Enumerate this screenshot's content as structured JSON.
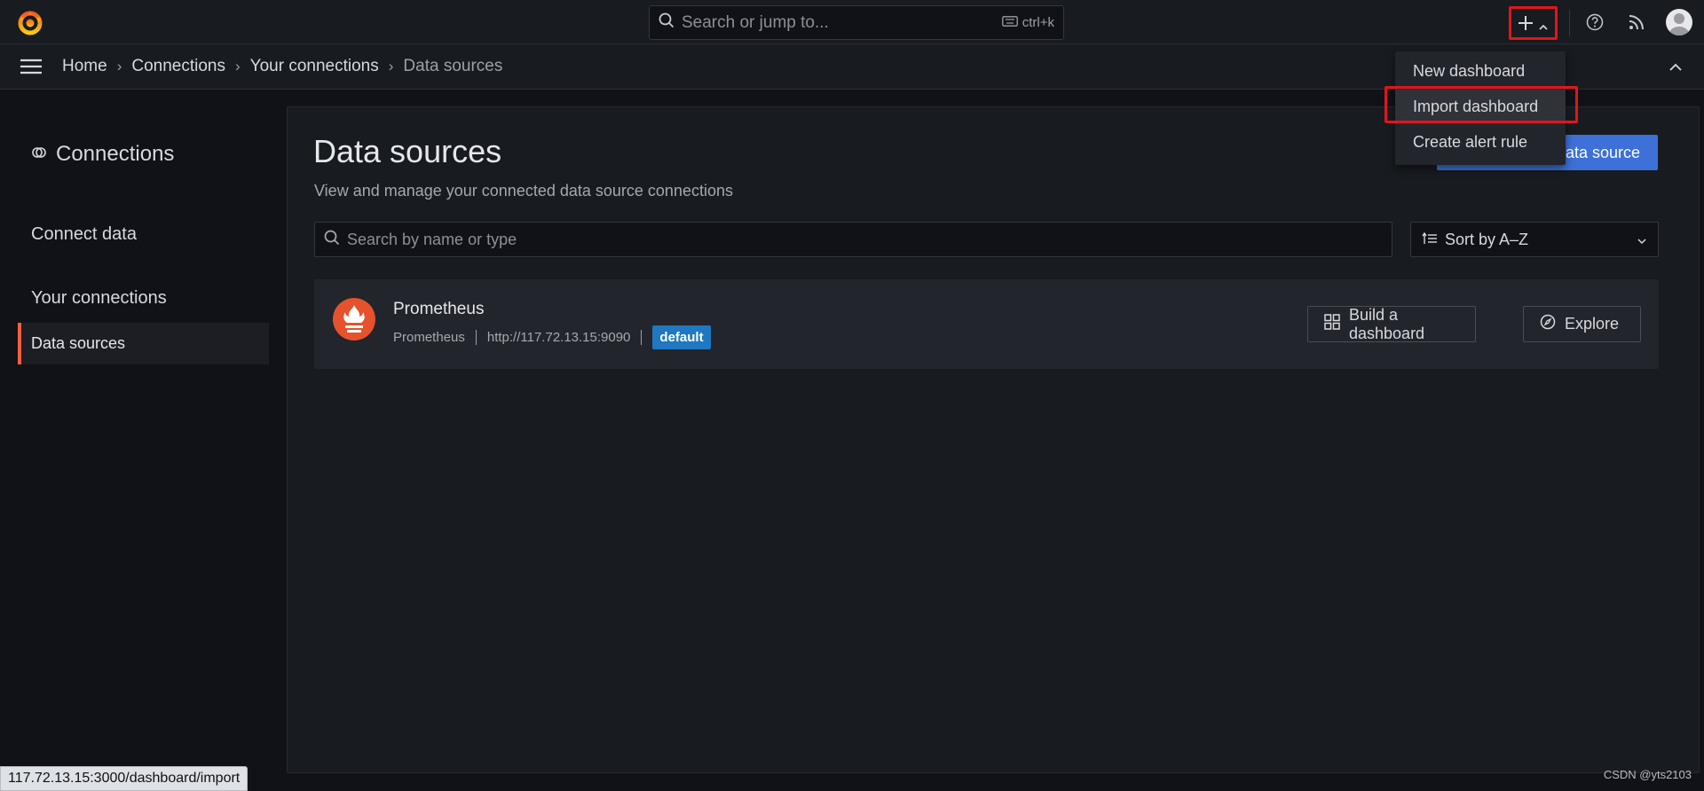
{
  "search": {
    "placeholder": "Search or jump to...",
    "shortcut": "ctrl+k"
  },
  "breadcrumb": {
    "items": [
      "Home",
      "Connections",
      "Your connections",
      "Data sources"
    ]
  },
  "sidebar": {
    "title": "Connections",
    "items": [
      {
        "label": "Connect data"
      },
      {
        "label": "Your connections"
      },
      {
        "label": "Data sources"
      }
    ]
  },
  "page": {
    "title": "Data sources",
    "subtitle": "View and manage your connected data source connections",
    "add_button_visible_text": "ata source"
  },
  "filter": {
    "search_placeholder": "Search by name or type",
    "sort_label": "Sort by A–Z"
  },
  "datasources": [
    {
      "name": "Prometheus",
      "type": "Prometheus",
      "url": "http://117.72.13.15:9090",
      "badge": "default",
      "build_button": "Build a dashboard",
      "explore_button": "Explore"
    }
  ],
  "new_menu": {
    "items": [
      "New dashboard",
      "Import dashboard",
      "Create alert rule"
    ],
    "highlighted": "Import dashboard"
  },
  "status_url": "117.72.13.15:3000/dashboard/import",
  "watermark": "CSDN @yts2103",
  "colors": {
    "accent": "#3d71d9",
    "active_marker": "#f55f3e",
    "badge": "#1f78c1",
    "annotation": "#e0161b"
  }
}
